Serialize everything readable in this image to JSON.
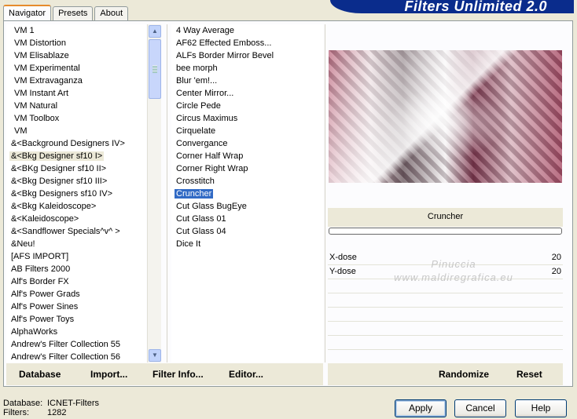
{
  "window": {
    "banner_title": "Filters Unlimited 2.0"
  },
  "tabs": [
    {
      "label": "Navigator",
      "active": true
    },
    {
      "label": "Presets",
      "active": false
    },
    {
      "label": "About",
      "active": false
    }
  ],
  "categories": [
    {
      "label": "VM 1",
      "indent": true
    },
    {
      "label": "VM Distortion",
      "indent": true
    },
    {
      "label": "VM Elisablaze",
      "indent": true
    },
    {
      "label": "VM Experimental",
      "indent": true
    },
    {
      "label": "VM Extravaganza",
      "indent": true
    },
    {
      "label": "VM Instant Art",
      "indent": true
    },
    {
      "label": "VM Natural",
      "indent": true
    },
    {
      "label": "VM Toolbox",
      "indent": true
    },
    {
      "label": "VM",
      "indent": true
    },
    {
      "label": "&<Background Designers IV>"
    },
    {
      "label": "&<Bkg Designer sf10 I>",
      "selected": true
    },
    {
      "label": "&<BKg Designer sf10 II>"
    },
    {
      "label": "&<Bkg Designer sf10 III>"
    },
    {
      "label": "&<Bkg Designers sf10 IV>"
    },
    {
      "label": "&<Bkg Kaleidoscope>"
    },
    {
      "label": "&<Kaleidoscope>"
    },
    {
      "label": "&<Sandflower Specials^v^ >"
    },
    {
      "label": "&Neu!"
    },
    {
      "label": "[AFS IMPORT]"
    },
    {
      "label": "AB Filters 2000"
    },
    {
      "label": "Alf's Border FX"
    },
    {
      "label": "Alf's Power Grads"
    },
    {
      "label": "Alf's Power Sines"
    },
    {
      "label": "Alf's Power Toys"
    },
    {
      "label": "AlphaWorks"
    },
    {
      "label": "Andrew's Filter Collection 55"
    },
    {
      "label": "Andrew's Filter Collection 56"
    }
  ],
  "filters": [
    {
      "label": "4 Way Average"
    },
    {
      "label": "AF62 Effected Emboss..."
    },
    {
      "label": "ALFs Border Mirror Bevel"
    },
    {
      "label": "bee morph"
    },
    {
      "label": "Blur 'em!..."
    },
    {
      "label": "Center Mirror..."
    },
    {
      "label": "Circle Pede"
    },
    {
      "label": "Circus Maximus"
    },
    {
      "label": "Cirquelate"
    },
    {
      "label": "Convergance"
    },
    {
      "label": "Corner Half Wrap"
    },
    {
      "label": "Corner Right Wrap"
    },
    {
      "label": "Crosstitch"
    },
    {
      "label": "Cruncher",
      "selected": true
    },
    {
      "label": "Cut Glass  BugEye"
    },
    {
      "label": "Cut Glass 01"
    },
    {
      "label": "Cut Glass 04"
    },
    {
      "label": "Dice It"
    }
  ],
  "preview": {
    "filter_name": "Cruncher"
  },
  "params": [
    {
      "name": "X-dose",
      "value": "20"
    },
    {
      "name": "Y-dose",
      "value": "20"
    }
  ],
  "watermark": {
    "line1": "Pinuccia",
    "line2": "www.maldiregrafica.eu"
  },
  "left_actions": {
    "database": "Database",
    "import": "Import...",
    "filter_info": "Filter Info...",
    "editor": "Editor..."
  },
  "right_actions": {
    "randomize": "Randomize",
    "reset": "Reset"
  },
  "status": {
    "database_label": "Database:",
    "database_value": "ICNET-Filters",
    "filters_label": "Filters:",
    "filters_value": "1282"
  },
  "buttons": {
    "apply": "Apply",
    "cancel": "Cancel",
    "help": "Help"
  },
  "colors": {
    "banner": "#0a2c8c",
    "selection": "#316ac5",
    "active_tab_accent": "#e68b2c"
  }
}
